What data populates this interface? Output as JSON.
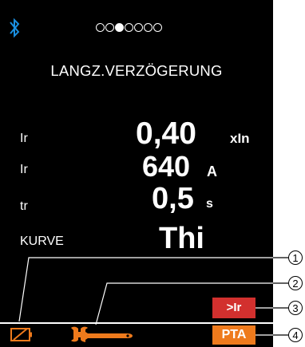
{
  "status": {
    "bluetooth_icon": "bluetooth-icon",
    "page_indicator": {
      "total": 7,
      "active_index": 2
    }
  },
  "title": "LANGZ.VERZÖGERUNG",
  "rows": [
    {
      "label": "Ir",
      "value": "0,40",
      "unit": "xIn"
    },
    {
      "label": "Ir",
      "value": "640",
      "unit": "A"
    },
    {
      "label": "tr",
      "value": "0,5",
      "unit": "s"
    },
    {
      "label": "KURVE",
      "value": "Thi",
      "unit": ""
    }
  ],
  "bottom_bar": {
    "battery_icon": "battery-empty-icon",
    "wrench_icon": "wrench-icon",
    "ir_badge": ">Ir",
    "pta_badge": "PTA",
    "colors": {
      "ir": "#d2302e",
      "pta": "#ee7a1c",
      "wrench": "#ee7a1c",
      "battery": "#ee7a1c"
    }
  },
  "callouts": [
    "1",
    "2",
    "3",
    "4"
  ]
}
